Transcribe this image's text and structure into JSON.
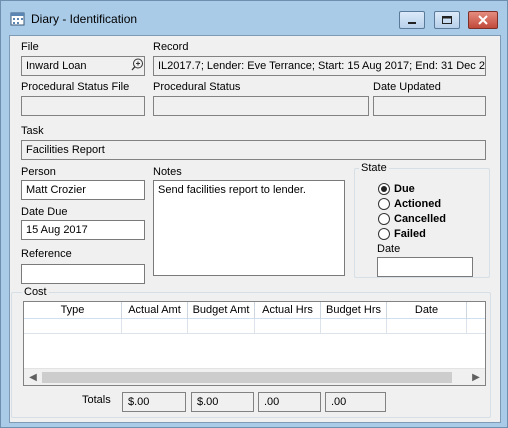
{
  "window": {
    "title": "Diary - Identification",
    "colors": {
      "titlebar": "#a9cbe8",
      "client": "#f0f0f0",
      "close_button": "#c14a3c"
    }
  },
  "file": {
    "label": "File",
    "value": "Inward Loan",
    "lookup_icon": "zoom-in-icon"
  },
  "record": {
    "label": "Record",
    "value": "IL2017.7; Lender: Eve Terrance; Start: 15 Aug 2017; End: 31 Dec 2"
  },
  "procedural_status_file": {
    "label": "Procedural Status File",
    "value": ""
  },
  "procedural_status": {
    "label": "Procedural Status",
    "value": ""
  },
  "date_updated": {
    "label": "Date Updated",
    "value": ""
  },
  "task": {
    "label": "Task",
    "value": "Facilities Report"
  },
  "person": {
    "label": "Person",
    "value": "Matt Crozier"
  },
  "date_due": {
    "label": "Date Due",
    "value": "15 Aug 2017"
  },
  "reference": {
    "label": "Reference",
    "value": ""
  },
  "notes": {
    "label": "Notes",
    "value": "Send facilities report to lender."
  },
  "state": {
    "label": "State",
    "options": [
      "Due",
      "Actioned",
      "Cancelled",
      "Failed"
    ],
    "selected": "Due",
    "date_label": "Date",
    "date_value": ""
  },
  "cost": {
    "label": "Cost",
    "columns": [
      "Type",
      "Actual Amt",
      "Budget Amt",
      "Actual Hrs",
      "Budget Hrs",
      "Date"
    ]
  },
  "totals": {
    "label": "Totals",
    "actual_amt": "$.00",
    "budget_amt": "$.00",
    "actual_hrs": ".00",
    "budget_hrs": ".00"
  }
}
